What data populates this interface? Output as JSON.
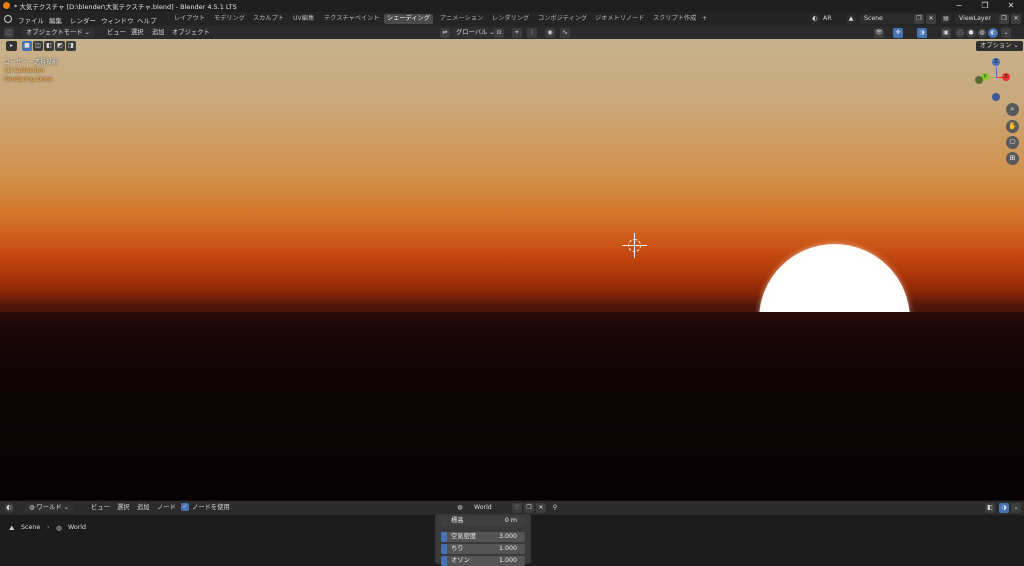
{
  "window": {
    "title": "* 大気テクスチャ [D:\\blender\\大気テクスチャ.blend] - Blender 4.5.1 LTS",
    "minimize": "−",
    "maximize": "❐",
    "close": "✕"
  },
  "menu": [
    "ファイル",
    "編集",
    "レンダー",
    "ウィンドウ",
    "ヘルプ"
  ],
  "workspaces": [
    "レイアウト",
    "モデリング",
    "スカルプト",
    "UV編集",
    "テクスチャペイント",
    "シェーディング",
    "アニメーション",
    "レンダリング",
    "コンポジティング",
    "ジオメトリノード",
    "スクリプト作成",
    "+"
  ],
  "active_workspace": "シェーディング",
  "topright": {
    "ar": "AR",
    "scene": "Scene",
    "view_layer": "ViewLayer"
  },
  "viewport_header": {
    "mode": "オブジェクトモード",
    "menus": [
      "ビュー",
      "選択",
      "追加",
      "オブジェクト"
    ],
    "orientation": "グローバル",
    "options": "オプション"
  },
  "viewport_overlay": {
    "view_name": "ユーザー・透視投影",
    "collection": "(1) Collection",
    "renderer": "Rendering Done"
  },
  "gizmo": {
    "x": "X",
    "y": "Y",
    "z": "Z"
  },
  "node_header": {
    "type": "ワールド",
    "menus": [
      "ビュー",
      "選択",
      "追加",
      "ノード"
    ],
    "use_nodes": "ノードを使用",
    "world_name": "World"
  },
  "breadcrumb": {
    "scene": "Scene",
    "sep": "›",
    "world": "World"
  },
  "properties": [
    {
      "label": "標高",
      "value": "0 m",
      "bar": false
    },
    {
      "label": "空気密度",
      "value": "3.000",
      "bar": true
    },
    {
      "label": "ちり",
      "value": "1.000",
      "bar": true
    },
    {
      "label": "オゾン",
      "value": "1.000",
      "bar": true
    }
  ],
  "colors": {
    "accent": "#4772b3",
    "sun": "#ffffff",
    "sky_top": "#c7b28d",
    "sky_horizon": "#cc5516"
  }
}
